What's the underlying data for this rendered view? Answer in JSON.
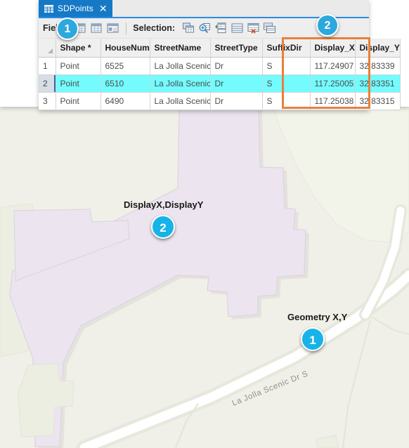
{
  "window": {
    "tab": {
      "icon": "table-grid-icon",
      "title": "SDPoints",
      "close": "✕"
    }
  },
  "toolbar": {
    "fields_label": "Fields:",
    "selection_label": "Selection:",
    "field_icons": [
      {
        "name": "add-field-icon"
      },
      {
        "name": "calculate-field-icon"
      },
      {
        "name": "field-properties-icon"
      }
    ],
    "selection_icons": [
      {
        "name": "select-by-attributes-icon"
      },
      {
        "name": "zoom-to-selection-icon"
      },
      {
        "name": "switch-selection-icon"
      },
      {
        "name": "select-all-icon"
      },
      {
        "name": "clear-selection-icon"
      },
      {
        "name": "copy-selection-icon"
      }
    ]
  },
  "table": {
    "columns": [
      {
        "key": "shape",
        "label": "Shape *",
        "cls": "w-shape"
      },
      {
        "key": "house",
        "label": "HouseNum",
        "cls": "w-house"
      },
      {
        "key": "street",
        "label": "StreetName",
        "cls": "w-street"
      },
      {
        "key": "stype",
        "label": "StreetType",
        "cls": "w-stype"
      },
      {
        "key": "sdir",
        "label": "SuffixDir",
        "cls": "w-sdir"
      },
      {
        "key": "dx",
        "label": "Display_X",
        "cls": "w-dx"
      },
      {
        "key": "dy",
        "label": "Display_Y",
        "cls": "w-dy"
      }
    ],
    "rows": [
      {
        "num": "1",
        "selected": false,
        "cells": [
          "Point",
          "6525",
          "La Jolla Scenic",
          "Dr",
          "S",
          "117.24907",
          "32.83339"
        ]
      },
      {
        "num": "2",
        "selected": true,
        "cells": [
          "Point",
          "6510",
          "La Jolla Scenic",
          "Dr",
          "S",
          "117.25005",
          "32.83351"
        ]
      },
      {
        "num": "3",
        "selected": false,
        "cells": [
          "Point",
          "6490",
          "La Jolla Scenic",
          "Dr",
          "S",
          "117.25038",
          "32.83315"
        ]
      }
    ]
  },
  "annotations": {
    "badge_fields": "1",
    "badge_display_columns": "2",
    "badge_map_display": "2",
    "badge_map_geometry": "1",
    "label_display": "DisplayX,DisplayY",
    "label_geometry": "Geometry X,Y",
    "highlight_color": "#e8803a",
    "badge_color": "#2ba8dd"
  },
  "map": {
    "street_label": "La Jolla Scenic Dr S",
    "colors": {
      "background": "#f0f0e8",
      "building": "#ece4ef",
      "road": "#ffffff",
      "landuse": "#eceee2"
    }
  }
}
